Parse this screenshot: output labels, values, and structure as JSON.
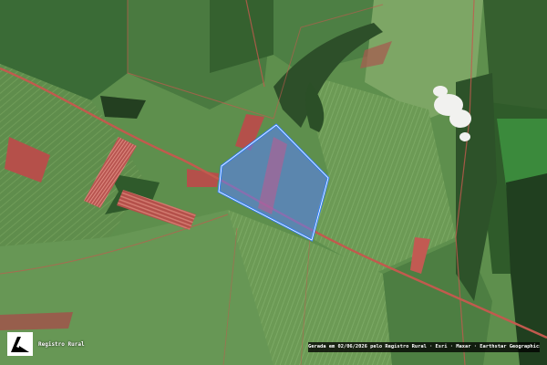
{
  "map": {
    "type": "satellite",
    "basemap": "Earthstar Geographics",
    "colors": {
      "parcel_stroke": "#2f7fff",
      "parcel_fill": "#5a7fff",
      "field_dark": "#2f5a2c",
      "field_light": "#6c9a55",
      "bare_soil": "#b7504a",
      "road": "#c25a4e"
    }
  },
  "brand": {
    "name": "Registro Rural",
    "logo_icon": "registro-rural-logo-icon"
  },
  "attribution": {
    "text": "Gerada em 02/06/2026 pelo Registro Rural · Esri · Maxar · Earthstar Geographics"
  }
}
